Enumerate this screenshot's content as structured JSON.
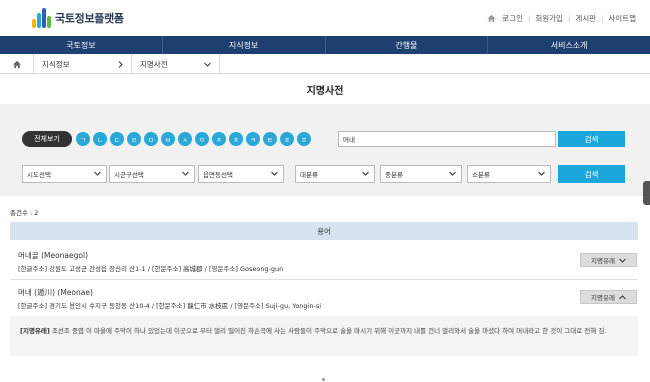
{
  "logo": {
    "text": "국토정보플랫폼",
    "bar_colors": [
      "#f2b705",
      "#2aa8d8",
      "#2b62b8",
      "#62b848"
    ]
  },
  "util": {
    "items": [
      "로그인",
      "회원가입",
      "게시판",
      "사이트맵"
    ]
  },
  "gnb": {
    "items": [
      "국토정보",
      "지식정보",
      "간행물",
      "서비스소개"
    ]
  },
  "breadcrumb": {
    "level1": "지식정보",
    "level2": "지명사전"
  },
  "page": {
    "title": "지명사전"
  },
  "search": {
    "all_label": "전체보기",
    "initials": [
      "ㄱ",
      "ㄴ",
      "ㄷ",
      "ㄹ",
      "ㅁ",
      "ㅂ",
      "ㅅ",
      "ㅇ",
      "ㅈ",
      "ㅊ",
      "ㅋ",
      "ㅌ",
      "ㅍ",
      "ㅎ"
    ],
    "keyword_value": "머내",
    "button_label": "검색",
    "filters": {
      "sido": "시도선택",
      "sigungu": "시군구선택",
      "eupmyeondong": "읍면동선택",
      "major": "대분류",
      "middle": "중분류",
      "minor": "소분류"
    },
    "button2_label": "검색"
  },
  "results": {
    "count_text": "총건수 : 2",
    "term_header": "용어",
    "entries": [
      {
        "title": "머내골 (Meonaegol)",
        "sub": "[한글주소] 강원도 고성군 간성읍 장신리 산1-1 / [한문주소] 高城郡 / [영문주소] Goseong-gun",
        "origin_label": "지명유래"
      },
      {
        "title": "머내 (遁川) (Meonae)",
        "sub": "[한글주소] 경기도 용인시 수지구 동천동 산10-4 / [한문주소] 龍仁市 水枝區 / [영문주소] Suji-gu, Yongin-si",
        "origin_label": "지명유래"
      }
    ],
    "desc_label": "[지명유래]",
    "desc_text": "조선조 중엽 이 마을에 주막이 하나 있었는데 이곳으로 부터 멀리 떨어진 하손곡에 사는 사람들이 주막으로 술을 마시기 위해 이곳까지 내를 건너 멀리와서 술을 마셨다 하여 머내라고 한 것이 그대로 전해 짐."
  }
}
